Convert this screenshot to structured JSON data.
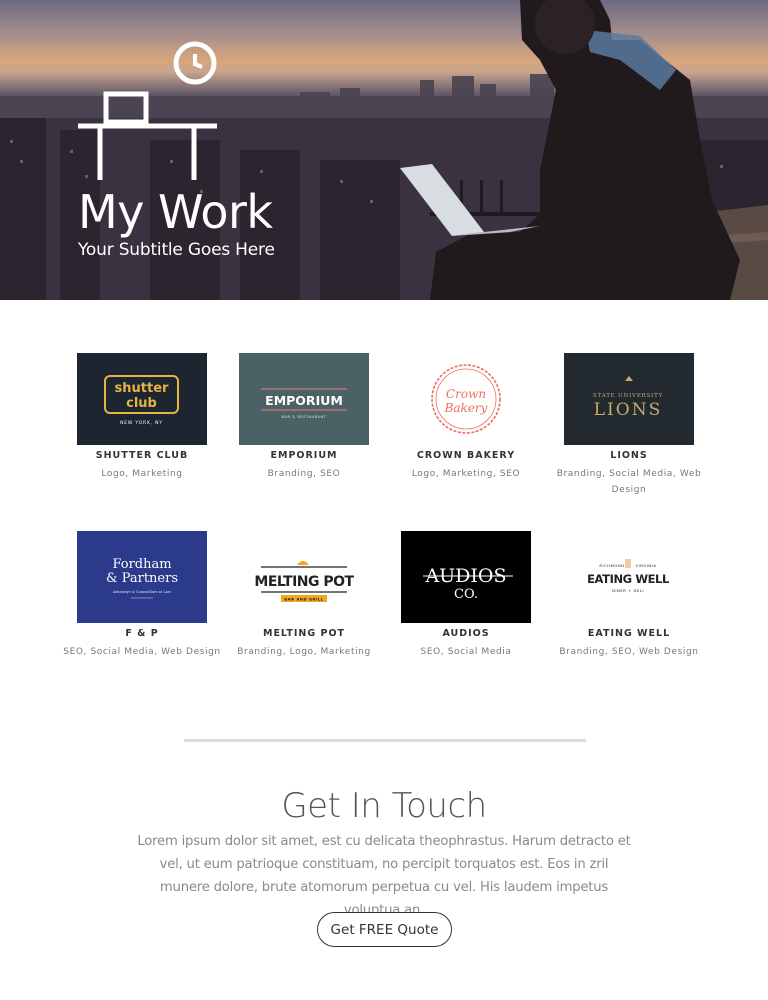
{
  "hero": {
    "title": "My Work",
    "subtitle": "Your Subtitle Goes Here",
    "icon": "desk-clock-icon"
  },
  "portfolio": [
    {
      "title": "SHUTTER CLUB",
      "tags": "Logo, Marketing",
      "logo_line1": "shutter",
      "logo_line2": "club",
      "logo_caption": "NEW YORK, NY",
      "bg": "#1c2530",
      "accent": "#e5b53f"
    },
    {
      "title": "EMPORIUM",
      "tags": "Branding, SEO",
      "logo_line1": "EMPORIUM",
      "logo_caption": "BAR & RESTAURANT",
      "bg": "#4a6265",
      "accent": "#e8806a"
    },
    {
      "title": "CROWN BAKERY",
      "tags": "Logo, Marketing, SEO",
      "logo_line1": "Crown",
      "logo_line2": "Bakery",
      "bg": "#ffffff",
      "accent": "#ef6e5c"
    },
    {
      "title": "LIONS",
      "tags": "Branding, Social Media, Web Design",
      "logo_line1": "STATE UNIVERSITY",
      "logo_line2": "LIONS",
      "bg": "#222a30",
      "accent": "#c9a96e"
    },
    {
      "title": "F & P",
      "tags": "SEO, Social Media, Web Design",
      "logo_line1": "Fordham",
      "logo_line2": "& Partners",
      "logo_caption": "Attorneys & Counsellors at Law",
      "bg": "#2b3a8a",
      "accent": "#ffffff"
    },
    {
      "title": "MELTING POT",
      "tags": "Branding, Logo, Marketing",
      "logo_line1": "MELTING POT",
      "logo_caption": "BAR AND GRILL",
      "bg": "#ffffff",
      "accent": "#f2a81f"
    },
    {
      "title": "AUDIOS",
      "tags": "SEO, Social Media",
      "logo_line1": "AUDIOS",
      "logo_line2": "CO.",
      "bg": "#000000",
      "accent": "#ffffff"
    },
    {
      "title": "EATING WELL",
      "tags": "Branding, SEO, Web Design",
      "logo_line1": "EATING WELL",
      "logo_top_left": "RICHMOND",
      "logo_top_right": "VIRGINIA",
      "logo_caption": "DINER + DELI",
      "bg": "#ffffff",
      "accent": "#e08a2d"
    }
  ],
  "contact": {
    "heading": "Get In Touch",
    "body": "Lorem ipsum dolor sit amet, est cu delicata theophrastus. Harum detracto et vel, ut eum patrioque constituam, no percipit torquatos est. Eos in zril munere dolore, brute atomorum perpetua cu vel. His laudem impetus voluptua an.",
    "button_label": "Get FREE Quote"
  }
}
